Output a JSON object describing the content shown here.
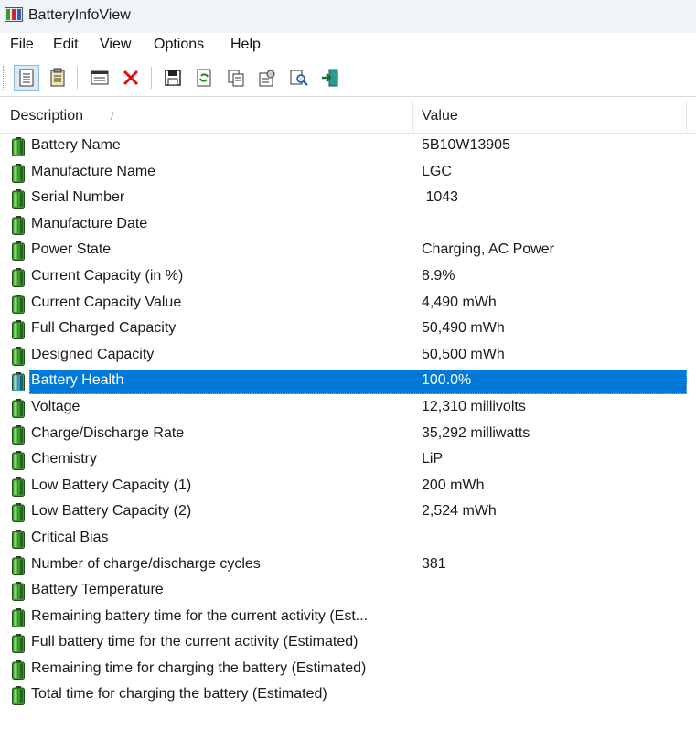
{
  "window": {
    "title": "BatteryInfoView"
  },
  "menu": [
    "File",
    "Edit",
    "View",
    "Options",
    "Help"
  ],
  "toolbar": {
    "buttons": [
      {
        "name": "view-details-icon"
      },
      {
        "name": "view-html-report-icon"
      },
      {
        "name": "properties-window-icon"
      },
      {
        "name": "delete-icon"
      },
      {
        "name": "save-icon"
      },
      {
        "name": "refresh-icon"
      },
      {
        "name": "copy-icon"
      },
      {
        "name": "options-icon"
      },
      {
        "name": "find-icon"
      },
      {
        "name": "exit-icon"
      }
    ]
  },
  "columns": {
    "description": "Description",
    "value": "Value"
  },
  "rows": [
    {
      "description": "Battery Name",
      "value": "5B10W13905"
    },
    {
      "description": "Manufacture Name",
      "value": "LGC"
    },
    {
      "description": "Serial Number",
      "value": " 1043"
    },
    {
      "description": "Manufacture Date",
      "value": ""
    },
    {
      "description": "Power State",
      "value": "Charging, AC Power"
    },
    {
      "description": "Current Capacity (in %)",
      "value": "8.9%"
    },
    {
      "description": "Current Capacity Value",
      "value": "4,490 mWh"
    },
    {
      "description": "Full Charged Capacity",
      "value": "50,490 mWh"
    },
    {
      "description": "Designed Capacity",
      "value": "50,500 mWh"
    },
    {
      "description": "Battery Health",
      "value": "100.0%",
      "selected": true
    },
    {
      "description": "Voltage",
      "value": "12,310 millivolts"
    },
    {
      "description": "Charge/Discharge Rate",
      "value": "35,292 milliwatts"
    },
    {
      "description": "Chemistry",
      "value": "LiP"
    },
    {
      "description": "Low Battery Capacity (1)",
      "value": "200 mWh"
    },
    {
      "description": "Low Battery Capacity (2)",
      "value": "2,524 mWh"
    },
    {
      "description": "Critical Bias",
      "value": ""
    },
    {
      "description": "Number of charge/discharge cycles",
      "value": "381"
    },
    {
      "description": "Battery Temperature",
      "value": ""
    },
    {
      "description": "Remaining battery time for the current activity (Est...",
      "value": ""
    },
    {
      "description": "Full battery time for the current activity (Estimated)",
      "value": ""
    },
    {
      "description": "Remaining time for charging the battery (Estimated)",
      "value": ""
    },
    {
      "description": "Total  time for charging the battery (Estimated)",
      "value": ""
    }
  ],
  "colors": {
    "selection": "#0078d7",
    "battery_green": "#3a9a2a"
  }
}
